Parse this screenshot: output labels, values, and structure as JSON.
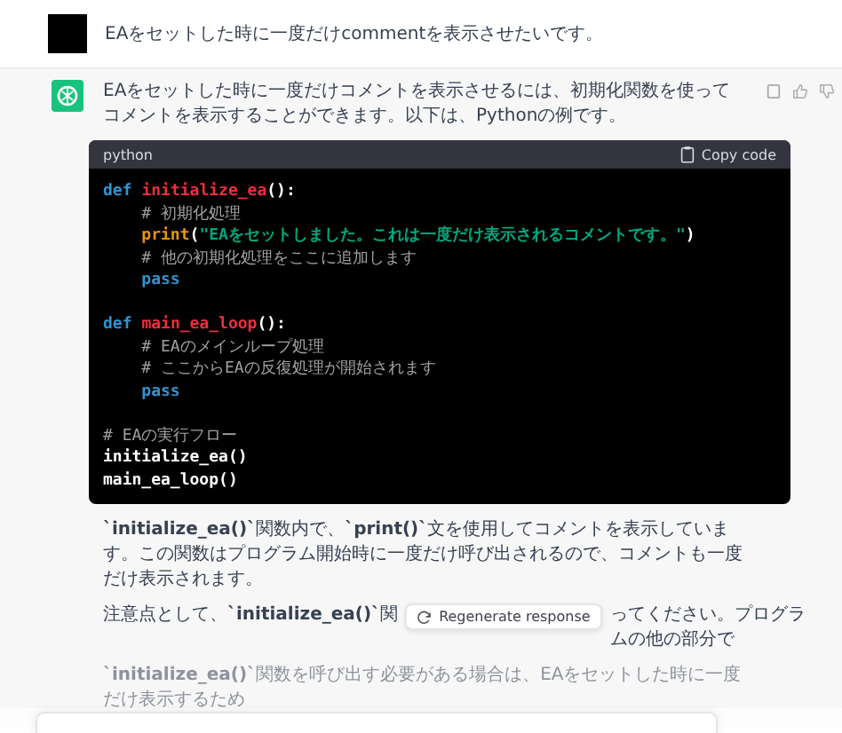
{
  "user_message": {
    "text": "EAをセットした時に一度だけcommentを表示させたいです。"
  },
  "assistant_message": {
    "intro": "EAをセットした時に一度だけコメントを表示させるには、初期化関数を使ってコメントを表示することができます。以下は、Pythonの例です。",
    "code_block": {
      "language": "python",
      "copy_label": "Copy code",
      "lines": [
        {
          "kind": "code",
          "tokens": [
            {
              "kind": "keyword",
              "text": "def "
            },
            {
              "kind": "function",
              "text": "initialize_ea"
            },
            {
              "kind": "plain",
              "text": "():"
            }
          ]
        },
        {
          "kind": "code",
          "tokens": [
            {
              "kind": "comment",
              "text": "    # 初期化処理"
            }
          ]
        },
        {
          "kind": "code",
          "tokens": [
            {
              "kind": "builtin",
              "text": "    print"
            },
            {
              "kind": "plain",
              "text": "("
            },
            {
              "kind": "string",
              "text": "\"EAをセットしました。これは一度だけ表示されるコメントです。\""
            },
            {
              "kind": "plain",
              "text": ")"
            }
          ]
        },
        {
          "kind": "code",
          "tokens": [
            {
              "kind": "comment",
              "text": "    # 他の初期化処理をここに追加します"
            }
          ]
        },
        {
          "kind": "code",
          "tokens": [
            {
              "kind": "keyword",
              "text": "    pass"
            }
          ]
        },
        {
          "kind": "blank"
        },
        {
          "kind": "code",
          "tokens": [
            {
              "kind": "keyword",
              "text": "def "
            },
            {
              "kind": "function",
              "text": "main_ea_loop"
            },
            {
              "kind": "plain",
              "text": "():"
            }
          ]
        },
        {
          "kind": "code",
          "tokens": [
            {
              "kind": "comment",
              "text": "    # EAのメインループ処理"
            }
          ]
        },
        {
          "kind": "code",
          "tokens": [
            {
              "kind": "comment",
              "text": "    # ここからEAの反復処理が開始されます"
            }
          ]
        },
        {
          "kind": "code",
          "tokens": [
            {
              "kind": "keyword",
              "text": "    pass"
            }
          ]
        },
        {
          "kind": "blank"
        },
        {
          "kind": "code",
          "tokens": [
            {
              "kind": "comment",
              "text": "# EAの実行フロー"
            }
          ]
        },
        {
          "kind": "code",
          "tokens": [
            {
              "kind": "plain",
              "text": "initialize_ea()"
            }
          ]
        },
        {
          "kind": "code",
          "tokens": [
            {
              "kind": "plain",
              "text": "main_ea_loop()"
            }
          ]
        }
      ]
    },
    "explanation": "**`initialize_ea()`**関数内で、**`print()`**文を使用してコメントを表示しています。この関数はプログラム開始時に一度だけ呼び出されるので、コメントも一度だけ表示されます。",
    "note": {
      "before": "注意点として、**`initialize_ea()`**関",
      "after": "ってください。プログラムの他の部分で",
      "next_line": "**`initialize_ea()`**関数を呼び出す必要がある場合は、EAをセットした時に一度だけ表示するため"
    }
  },
  "regenerate_button": {
    "label": "Regenerate response"
  }
}
